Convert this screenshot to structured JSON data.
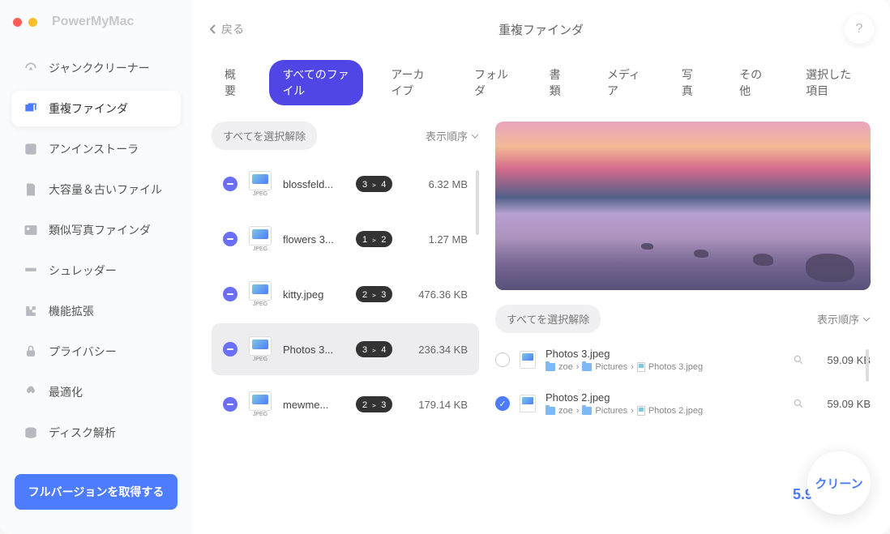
{
  "app_title": "PowerMyMac",
  "back_label": "戻る",
  "header_title": "重複ファインダ",
  "help_label": "?",
  "nav": [
    {
      "label": "ジャンククリーナー"
    },
    {
      "label": "重複ファインダ"
    },
    {
      "label": "アンインストーラ"
    },
    {
      "label": "大容量＆古いファイル"
    },
    {
      "label": "類似写真ファインダ"
    },
    {
      "label": "シュレッダー"
    },
    {
      "label": "機能拡張"
    },
    {
      "label": "プライバシー"
    },
    {
      "label": "最適化"
    },
    {
      "label": "ディスク解析"
    }
  ],
  "upgrade_label": "フルバージョンを取得する",
  "tabs": [
    {
      "label": "概要"
    },
    {
      "label": "すべてのファイル"
    },
    {
      "label": "アーカイブ"
    },
    {
      "label": "フォルダ"
    },
    {
      "label": "書類"
    },
    {
      "label": "メディア"
    },
    {
      "label": "写真"
    },
    {
      "label": "その他"
    },
    {
      "label": "選択した項目"
    }
  ],
  "deselect_all": "すべてを選択解除",
  "sort_label": "表示順序",
  "thumb_type": "JPEG",
  "files": [
    {
      "name": "blossfeld...",
      "badge": "3 ﹥ 4",
      "size": "6.32 MB"
    },
    {
      "name": "flowers 3...",
      "badge": "1 ﹥ 2",
      "size": "1.27 MB"
    },
    {
      "name": "kitty.jpeg",
      "badge": "2 ﹥ 3",
      "size": "476.36 KB"
    },
    {
      "name": "Photos 3...",
      "badge": "3 ﹥ 4",
      "size": "236.34 KB"
    },
    {
      "name": "mewme...",
      "badge": "2 ﹥ 3",
      "size": "179.14 KB"
    }
  ],
  "dup_toolbar": {
    "deselect": "すべてを選択解除",
    "sort": "表示順序"
  },
  "dups": [
    {
      "name": "Photos 3.jpeg",
      "path": [
        "zoe",
        "Pictures",
        "Photos 3.jpeg"
      ],
      "size": "59.09 KB",
      "checked": false
    },
    {
      "name": "Photos 2.jpeg",
      "path": [
        "zoe",
        "Pictures",
        "Photos 2.jpeg"
      ],
      "size": "59.09 KB",
      "checked": true
    }
  ],
  "path_sep": "›",
  "total_size": "5.98 MB",
  "clean_label": "クリーン"
}
